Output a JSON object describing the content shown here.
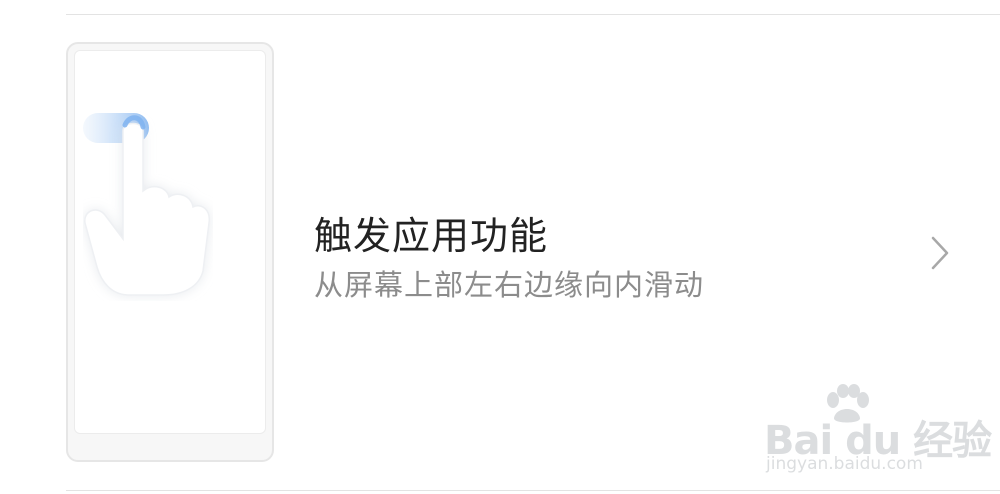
{
  "setting": {
    "title": "触发应用功能",
    "subtitle": "从屏幕上部左右边缘向内滑动"
  },
  "icons": {
    "illustration": "phone-swipe-gesture-illustration",
    "chevron": "chevron-right-icon"
  },
  "watermark": {
    "brand": "Bai du 经验",
    "url": "jingyan.baidu.com"
  },
  "colors": {
    "title": "#222222",
    "subtitle": "#8c8c8c",
    "divider": "#e3e3e3",
    "gesture_accent": "#7fb3f0"
  }
}
